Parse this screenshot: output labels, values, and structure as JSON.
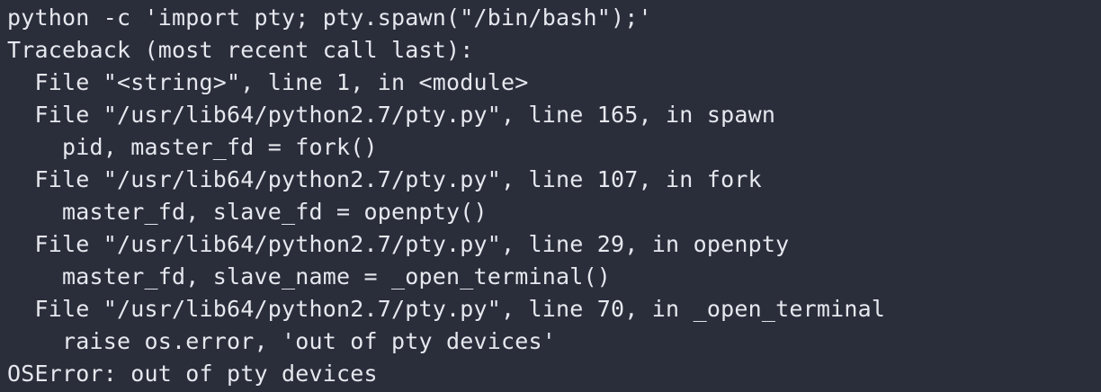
{
  "terminal": {
    "background": "#2a2e3b",
    "foreground": "#e6e8ee",
    "lines": [
      "python -c 'import pty; pty.spawn(\"/bin/bash\");'",
      "Traceback (most recent call last):",
      "  File \"<string>\", line 1, in <module>",
      "  File \"/usr/lib64/python2.7/pty.py\", line 165, in spawn",
      "    pid, master_fd = fork()",
      "  File \"/usr/lib64/python2.7/pty.py\", line 107, in fork",
      "    master_fd, slave_fd = openpty()",
      "  File \"/usr/lib64/python2.7/pty.py\", line 29, in openpty",
      "    master_fd, slave_name = _open_terminal()",
      "  File \"/usr/lib64/python2.7/pty.py\", line 70, in _open_terminal",
      "    raise os.error, 'out of pty devices'",
      "OSError: out of pty devices"
    ]
  }
}
